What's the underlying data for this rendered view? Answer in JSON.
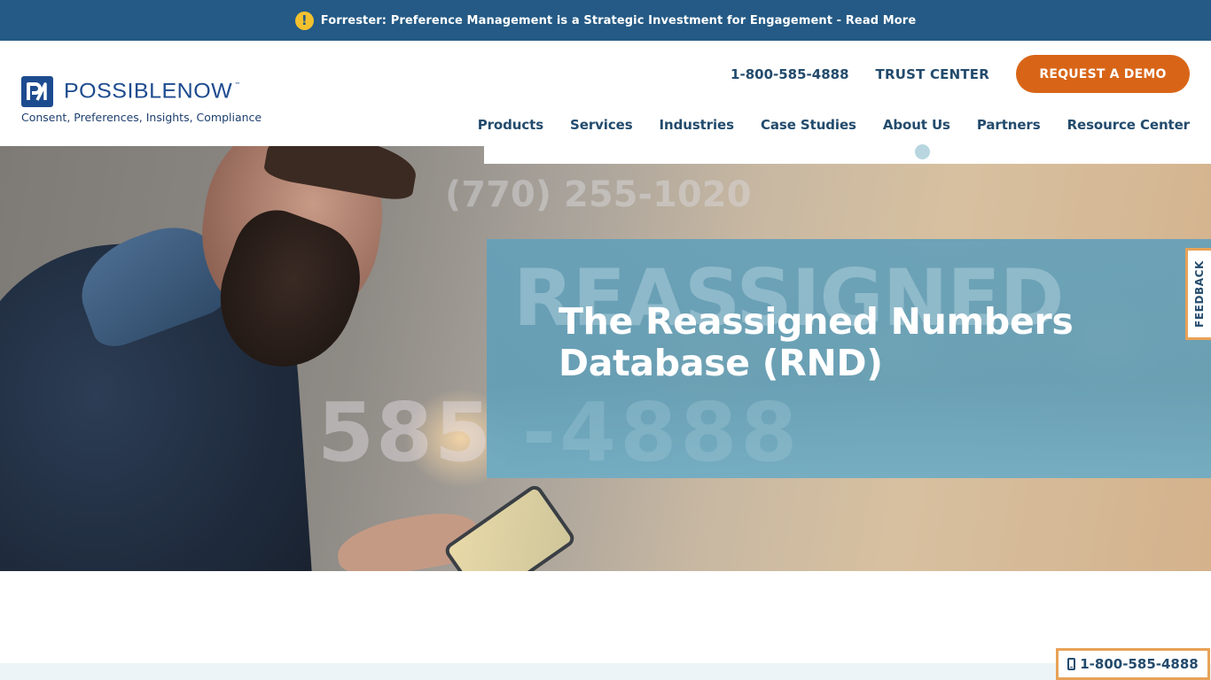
{
  "announcement": {
    "icon": "exclamation-icon",
    "text": "Forrester: Preference Management is a Strategic Investment for Engagement - Read More"
  },
  "brand": {
    "logo_mark": "PN",
    "name": "POSSIBLENOW",
    "trademark": "™",
    "tagline": "Consent, Preferences, Insights, Compliance",
    "colors": {
      "primary": "#1d4b8f",
      "nav_text": "#234b6d",
      "accent_orange": "#d86517",
      "announce_bg": "#245a85",
      "hero_panel": "#64a0b9"
    }
  },
  "utility": {
    "phone": "1-800-585-4888",
    "trust_center": "TRUST CENTER",
    "demo_button": "REQUEST A DEMO"
  },
  "nav": {
    "items": [
      {
        "label": "Products"
      },
      {
        "label": "Services"
      },
      {
        "label": "Industries"
      },
      {
        "label": "Case Studies"
      },
      {
        "label": "About Us"
      },
      {
        "label": "Partners"
      },
      {
        "label": "Resource Center"
      }
    ]
  },
  "hero": {
    "title": "The Reassigned Numbers Database (RND)",
    "background_text": {
      "phone_number": "(770) 255-1020",
      "word": "REASSIGNED",
      "digits_left": "585",
      "digits_right": "-4888"
    }
  },
  "feedback_tab": {
    "label": "FEEDBACK"
  },
  "floating_call": {
    "icon": "mobile-phone-icon",
    "phone": "1-800-585-4888"
  }
}
